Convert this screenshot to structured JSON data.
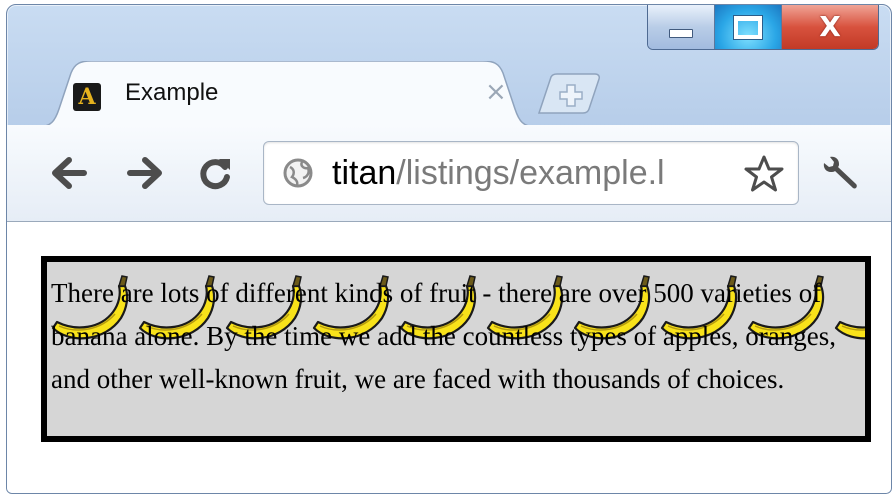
{
  "window": {
    "controls": [
      "minimize",
      "maximize",
      "close"
    ],
    "colors": {
      "close": "#d8523e",
      "maximize": "#2aa6e6"
    }
  },
  "tab": {
    "favicon_letter": "A",
    "title": "Example",
    "close_glyph": "×"
  },
  "new_tab": {
    "icon": "plus-icon"
  },
  "toolbar": {
    "back_icon": "arrow-left-icon",
    "forward_icon": "arrow-right-icon",
    "reload_icon": "reload-icon",
    "url_host": "titan",
    "url_path": "/listings/example.l",
    "bookmark_icon": "star-icon",
    "wrench_icon": "wrench-icon"
  },
  "page": {
    "paragraph": "There are lots of different kinds of fruit - there are over 500 varieties of banana alone. By the time we add the countless types of apples, oranges, and other well-known fruit, we are faced with thousands of choices.",
    "background_image": "banana-icon",
    "box_color": "#d6d6d6",
    "border_color": "#000000"
  }
}
